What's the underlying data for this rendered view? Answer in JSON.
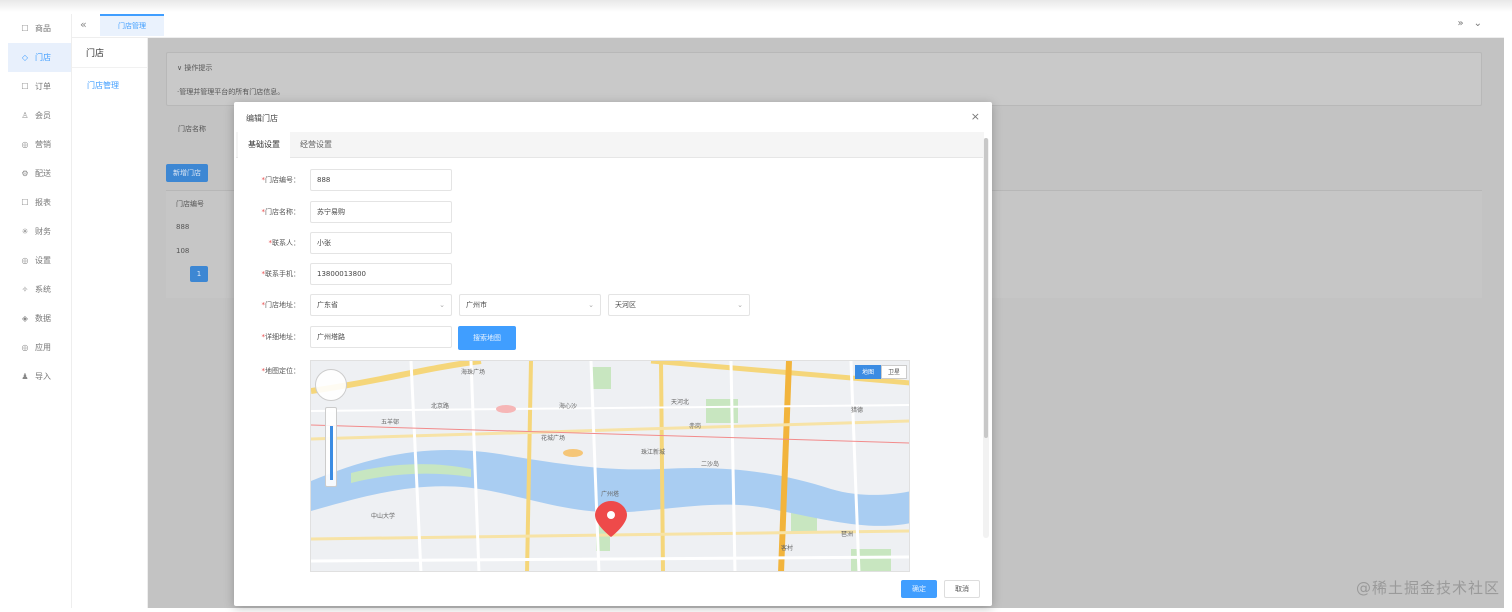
{
  "sidebar": {
    "items": [
      {
        "icon": "goods-icon",
        "glyph": "☐",
        "label": "商品"
      },
      {
        "icon": "store-icon",
        "glyph": "◇",
        "label": "门店",
        "active": true
      },
      {
        "icon": "order-icon",
        "glyph": "☐",
        "label": "订单"
      },
      {
        "icon": "member-icon",
        "glyph": "♙",
        "label": "会员"
      },
      {
        "icon": "marketing-icon",
        "glyph": "◎",
        "label": "营销"
      },
      {
        "icon": "delivery-icon",
        "glyph": "⚙",
        "label": "配送"
      },
      {
        "icon": "report-icon",
        "glyph": "☐",
        "label": "报表"
      },
      {
        "icon": "finance-icon",
        "glyph": "✳",
        "label": "财务"
      },
      {
        "icon": "settings-icon",
        "glyph": "◎",
        "label": "设置"
      },
      {
        "icon": "system-icon",
        "glyph": "✧",
        "label": "系统"
      },
      {
        "icon": "data-icon",
        "glyph": "◈",
        "label": "数据"
      },
      {
        "icon": "app-icon",
        "glyph": "◎",
        "label": "应用"
      },
      {
        "icon": "import-icon",
        "glyph": "♟",
        "label": "导入"
      }
    ]
  },
  "subsidebar": {
    "title": "门店",
    "items": [
      "门店管理"
    ]
  },
  "tabbar": {
    "collapse_glyph": "«",
    "tab_label": "门店管理",
    "right_glyphs": "»⌄"
  },
  "background_page": {
    "panel_title": "∨ 操作提示",
    "panel_desc": "·管理并管理平台的所有门店信息。",
    "search_label": "门店名称",
    "add_button": "新增门店",
    "table_header": "门店编号",
    "rows": [
      "888",
      "108"
    ],
    "current_page": "1"
  },
  "dialog": {
    "title": "编辑门店",
    "close_glyph": "×",
    "tabs": [
      "基础设置",
      "经营设置"
    ],
    "fields": {
      "store_no": {
        "label": "门店编号：",
        "value": "888"
      },
      "store_name": {
        "label": "门店名称：",
        "value": "苏宁易购"
      },
      "contact": {
        "label": "联系人：",
        "value": "小张"
      },
      "phone": {
        "label": "联系手机：",
        "value": "13800013800"
      },
      "address": {
        "label": "门店地址：",
        "province": "广东省",
        "city": "广州市",
        "district": "天河区"
      },
      "detail_address": {
        "label": "详细地址：",
        "value": "广州塔路",
        "search_button": "搜索地图"
      },
      "map": {
        "label": "地图定位：",
        "type_map": "地图",
        "type_satellite": "卫星"
      }
    },
    "ok": "确定",
    "cancel": "取消"
  },
  "map_labels": [
    "海珠广场",
    "北京路",
    "五羊邨",
    "花城广场",
    "广州塔",
    "中山大学",
    "珠江新城",
    "天河北",
    "海心沙",
    "二沙岛",
    "猎德",
    "客村",
    "赤岗",
    "琶洲"
  ],
  "watermark": "@稀土掘金技术社区"
}
